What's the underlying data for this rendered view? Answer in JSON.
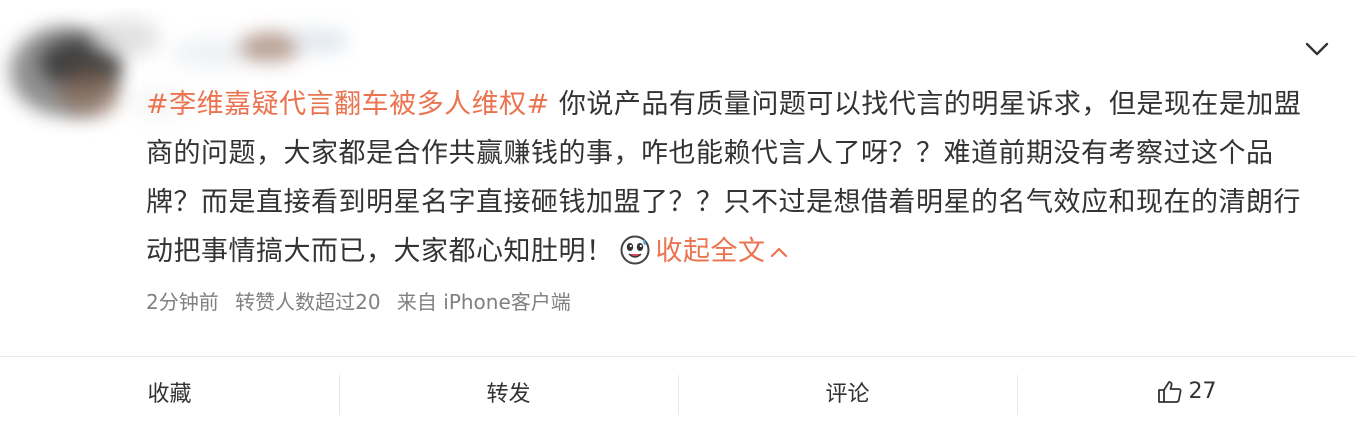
{
  "post": {
    "topic": "#李维嘉疑代言翻车被多人维权#",
    "body": "你说产品有质量问题可以找代言的明星诉求，但是现在是加盟商的问题，大家都是合作共赢赚钱的事，咋也能赖代言人了呀？？难道前期没有考察过这个品牌？而是直接看到明星名字直接砸钱加盟了？？只不过是想借着明星的名气效应和现在的清朗行动把事情搞大而已，大家都心知肚明！",
    "emoji_icon": "sweat-smile-emoji-icon",
    "collapse_label": "收起全文"
  },
  "meta": {
    "time": "2分钟前",
    "reposts": "转赞人数超过20",
    "source": "来自 iPhone客户端"
  },
  "actions": {
    "favorite": "收藏",
    "repost": "转发",
    "comment": "评论",
    "like_count": "27"
  },
  "colors": {
    "accent": "#eb7350",
    "text": "#333333",
    "meta": "#808080"
  }
}
